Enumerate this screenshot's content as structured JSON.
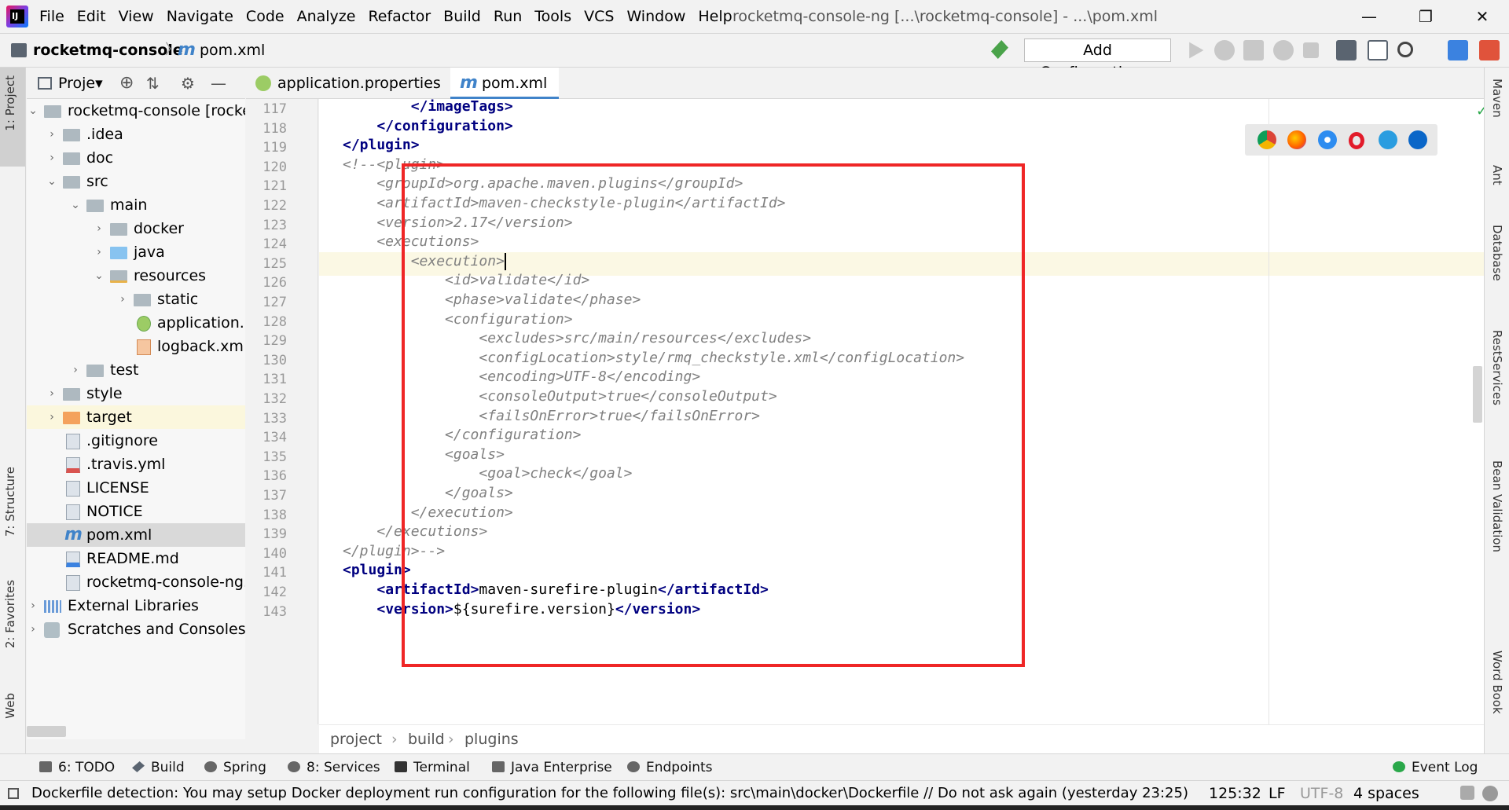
{
  "menu": [
    "File",
    "Edit",
    "View",
    "Navigate",
    "Code",
    "Analyze",
    "Refactor",
    "Build",
    "Run",
    "Tools",
    "VCS",
    "Window",
    "Help"
  ],
  "window_title": "rocketmq-console-ng [...\\rocketmq-console] - ...\\pom.xml",
  "app_logo_text": "IJ",
  "window_controls": [
    "—",
    "❐",
    "✕"
  ],
  "nav": {
    "project": "rocketmq-console",
    "file": "pom.xml",
    "separator": "〉",
    "maven_icon": "m",
    "add_config": "Add Configuration..."
  },
  "project_panel": {
    "title": "Proje▾",
    "icons": [
      "⊕",
      "⇅",
      "⚙",
      "—"
    ]
  },
  "left_tabs": [
    "1: Project",
    "7: Structure",
    "2: Favorites",
    "Web"
  ],
  "right_tabs": [
    "Maven",
    "Ant",
    "Database",
    "RestServices",
    "Bean Validation",
    "Word Book"
  ],
  "tree": [
    {
      "label": "rocketmq-console [rocke",
      "arrow": "⌄"
    },
    {
      "label": ".idea",
      "arrow": "›"
    },
    {
      "label": "doc",
      "arrow": "›"
    },
    {
      "label": "src",
      "arrow": "⌄"
    },
    {
      "label": "main",
      "arrow": "⌄"
    },
    {
      "label": "docker",
      "arrow": "›"
    },
    {
      "label": "java",
      "arrow": "›"
    },
    {
      "label": "resources",
      "arrow": "⌄"
    },
    {
      "label": "static",
      "arrow": "›"
    },
    {
      "label": "application.",
      "arrow": ""
    },
    {
      "label": "logback.xm",
      "arrow": ""
    },
    {
      "label": "test",
      "arrow": "›"
    },
    {
      "label": "style",
      "arrow": "›"
    },
    {
      "label": "target",
      "arrow": "›"
    },
    {
      "label": ".gitignore",
      "arrow": ""
    },
    {
      "label": ".travis.yml",
      "arrow": ""
    },
    {
      "label": "LICENSE",
      "arrow": ""
    },
    {
      "label": "NOTICE",
      "arrow": ""
    },
    {
      "label": "pom.xml",
      "arrow": ""
    },
    {
      "label": "README.md",
      "arrow": ""
    },
    {
      "label": "rocketmq-console-ng.",
      "arrow": ""
    },
    {
      "label": "External Libraries",
      "arrow": "›"
    },
    {
      "label": "Scratches and Consoles",
      "arrow": "›"
    }
  ],
  "tabs": [
    {
      "label": "application.properties",
      "close": "×"
    },
    {
      "label": "pom.xml",
      "close": "×"
    }
  ],
  "lines": [
    "117",
    "118",
    "119",
    "120",
    "121",
    "122",
    "123",
    "124",
    "125",
    "126",
    "127",
    "128",
    "129",
    "130",
    "131",
    "132",
    "133",
    "134",
    "135",
    "136",
    "137",
    "138",
    "139",
    "140",
    "141",
    "142",
    "143"
  ],
  "code": [
    "        </imageTags>",
    "    </configuration>",
    "</plugin>",
    "<!--<plugin>",
    "    <groupId>org.apache.maven.plugins</groupId>",
    "    <artifactId>maven-checkstyle-plugin</artifactId>",
    "    <version>2.17</version>",
    "    <executions>",
    "        <execution>",
    "            <id>validate</id>",
    "            <phase>validate</phase>",
    "            <configuration>",
    "                <excludes>src/main/resources</excludes>",
    "                <configLocation>style/rmq_checkstyle.xml</configLocation>",
    "                <encoding>UTF-8</encoding>",
    "                <consoleOutput>true</consoleOutput>",
    "                <failsOnError>true</failsOnError>",
    "            </configuration>",
    "            <goals>",
    "                <goal>check</goal>",
    "            </goals>",
    "        </execution>",
    "    </executions>",
    "</plugin>-->",
    "<plugin>",
    "    <artifactId>maven-surefire-plugin</artifactId>",
    "    <version>${surefire.version}</version>"
  ],
  "breadcrumb": [
    "project",
    "build",
    "plugins"
  ],
  "breadcrumb_sep": "›",
  "tool_windows": [
    "6: TODO",
    "Build",
    "Spring",
    "8: Services",
    "Terminal",
    "Java Enterprise",
    "Endpoints",
    "Event Log"
  ],
  "status": {
    "message": "Dockerfile detection: You may setup Docker deployment run configuration for the following file(s): src\\main\\docker\\Dockerfile // Do not ask again (yesterday 23:25)",
    "position": "125:32",
    "line_sep": "LF",
    "encoding": "UTF-8",
    "indent": "4 spaces"
  },
  "checkmark": "✓",
  "colors": {
    "accent": "#4083c9",
    "highlight": "#ef2626",
    "caret_line": "#fbf8e4",
    "tag": "#000080",
    "comment": "#808080"
  }
}
